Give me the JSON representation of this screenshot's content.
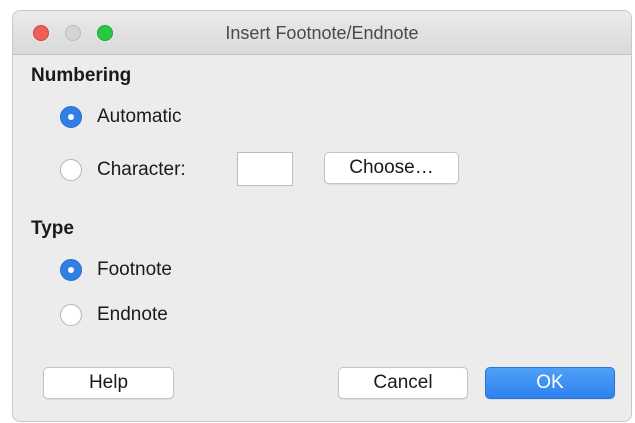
{
  "window": {
    "title": "Insert Footnote/Endnote"
  },
  "numbering": {
    "heading": "Numbering",
    "options": [
      {
        "label": "Automatic",
        "selected": true
      },
      {
        "label": "Character:",
        "selected": false
      }
    ],
    "character_value": "",
    "choose_label": "Choose…"
  },
  "type": {
    "heading": "Type",
    "options": [
      {
        "label": "Footnote",
        "selected": true
      },
      {
        "label": "Endnote",
        "selected": false
      }
    ]
  },
  "buttons": {
    "help": "Help",
    "cancel": "Cancel",
    "ok": "OK"
  },
  "colors": {
    "accent": "#2f7fe5",
    "close": "#ee5d57",
    "maximize": "#27c93f"
  },
  "icons": [
    "close-dot-icon",
    "minimize-dot-icon",
    "maximize-dot-icon"
  ]
}
